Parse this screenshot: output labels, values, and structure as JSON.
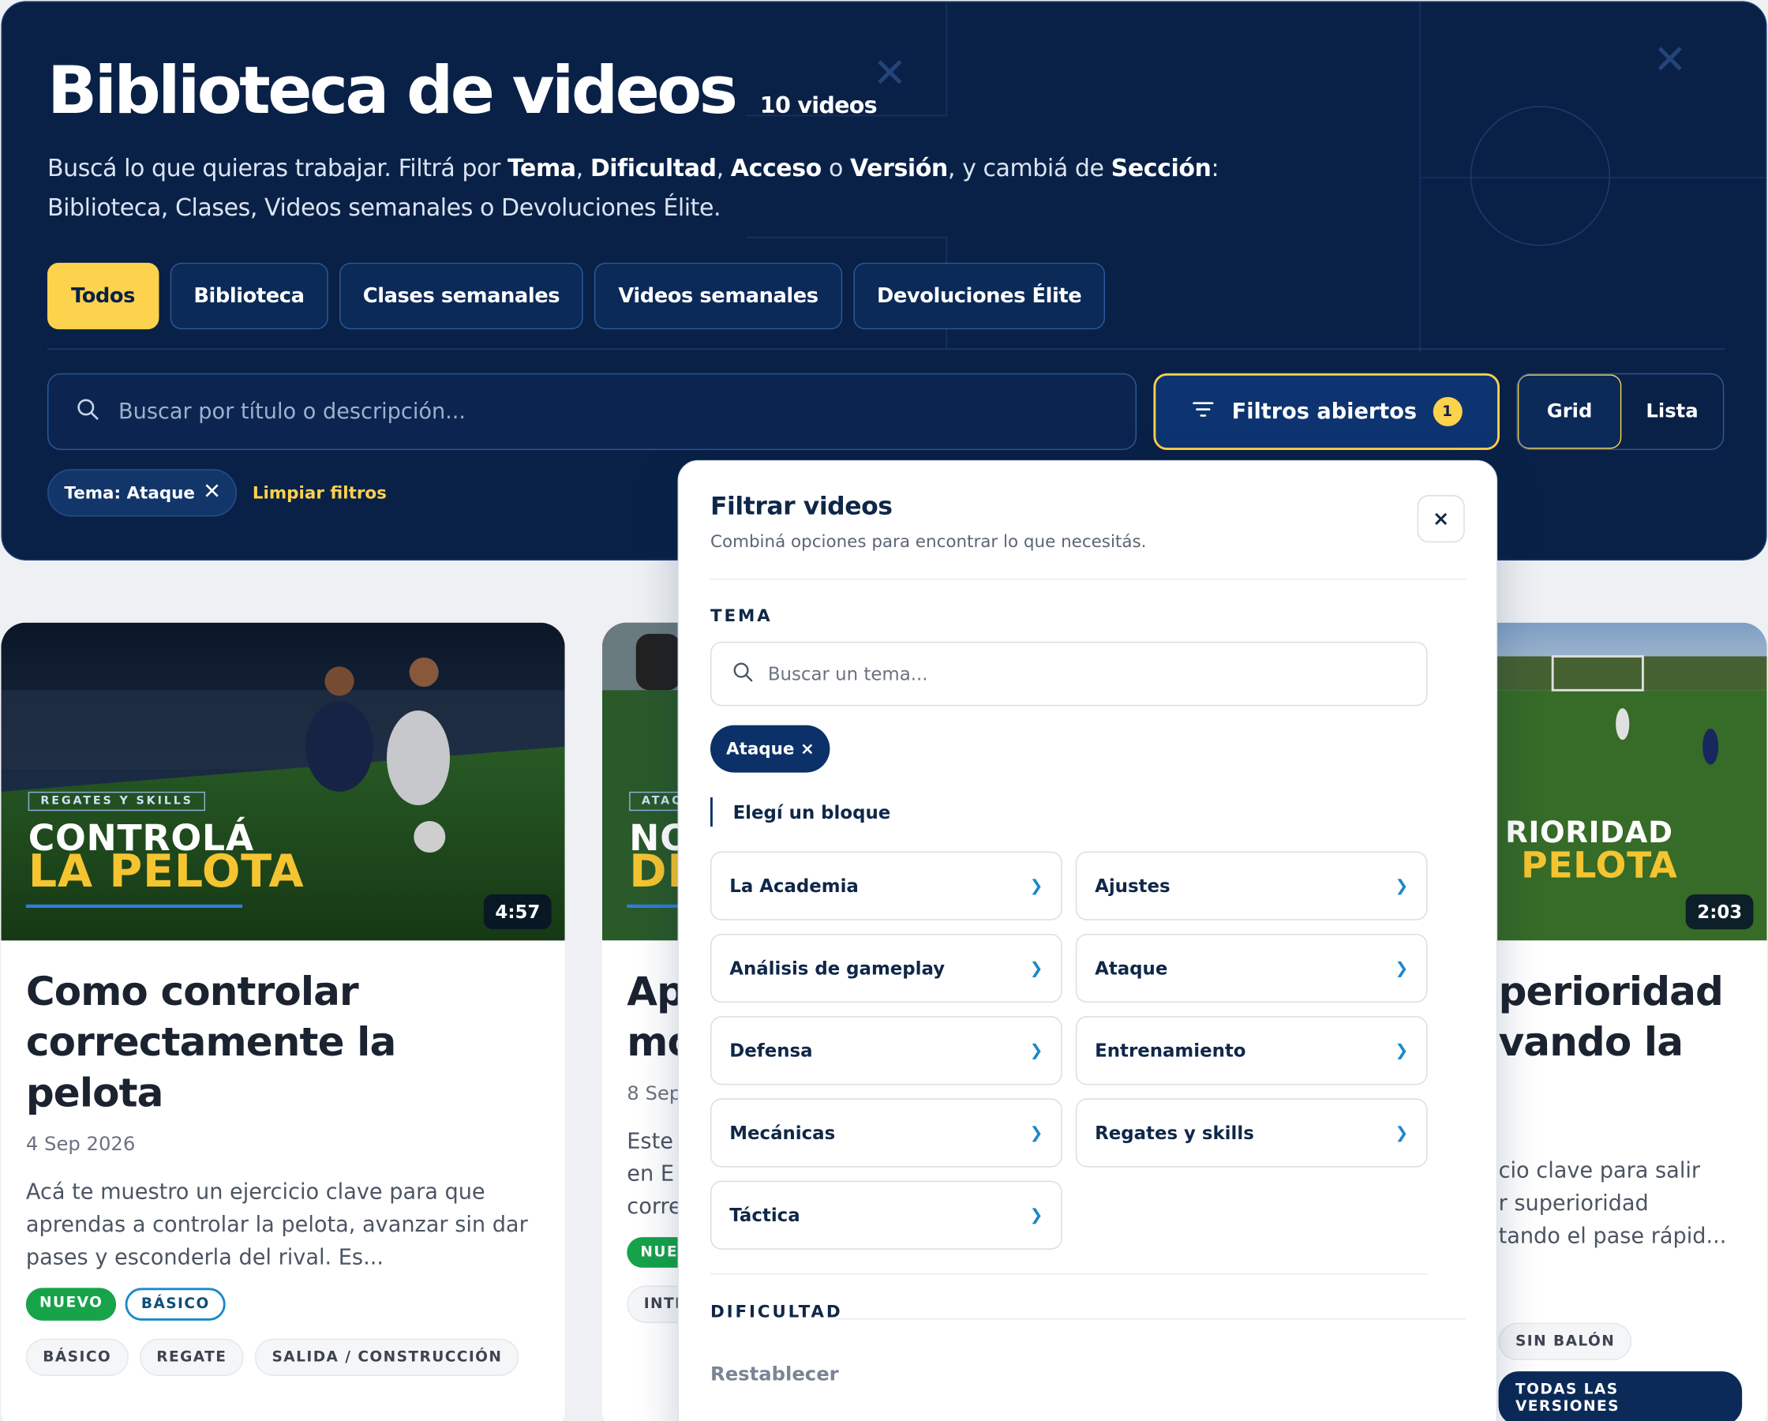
{
  "hero": {
    "title": "Biblioteca de videos",
    "count": "10 videos",
    "desc_1": "Buscá lo que quieras trabajar. Filtrá por ",
    "desc_tema": "Tema",
    "desc_c1": ", ",
    "desc_dificultad": "Dificultad",
    "desc_c2": ", ",
    "desc_acceso": "Acceso",
    "desc_o": " o ",
    "desc_version": "Versión",
    "desc_2": ", y cambiá de ",
    "desc_seccion": "Sección",
    "desc_3": ": Biblioteca, Clases, Videos semanales o Devoluciones Élite."
  },
  "tabs": [
    {
      "label": "Todos",
      "active": true
    },
    {
      "label": "Biblioteca",
      "active": false
    },
    {
      "label": "Clases semanales",
      "active": false
    },
    {
      "label": "Videos semanales",
      "active": false
    },
    {
      "label": "Devoluciones Élite",
      "active": false
    }
  ],
  "search": {
    "placeholder": "Buscar por título o descripción..."
  },
  "filters_button": {
    "label": "Filtros abiertos",
    "count": "1"
  },
  "view_toggle": {
    "grid": "Grid",
    "list": "Lista",
    "active": "grid"
  },
  "active_filters": {
    "chip": "Tema: Ataque",
    "clear": "Limpiar filtros"
  },
  "cards": [
    {
      "kicker": "REGATES Y SKILLS",
      "thumb_line1": "CONTROLÁ",
      "thumb_line2": "LA PELOTA",
      "duration": "4:57",
      "title": "Como controlar correctamente la pelota",
      "date": "4 Sep 2026",
      "desc": "Acá te muestro un ejercicio clave para que aprendas a controlar la pelota, avanzar sin dar pases y esconderla del rival. Es...",
      "badge_new": "NUEVO",
      "badge_level": "BÁSICO",
      "tags": [
        "BÁSICO",
        "REGATE",
        "SALIDA / CONSTRUCCIÓN"
      ]
    },
    {
      "kicker": "ATAQ",
      "thumb_line1": "NO",
      "thumb_line2": "DE",
      "title_visible": "Ap",
      "title_visible2": "mo",
      "date_visible": "8 Sep",
      "desc_visible_1": "Este",
      "desc_visible_2": "en E",
      "desc_visible_3": "corre",
      "badge_new": "NUE",
      "tag_visible": "INTE"
    },
    {
      "thumb_line1": "RIORIDAD",
      "thumb_line2": "PELOTA",
      "duration": "2:03",
      "title_visible": "perioridad",
      "title_visible2": "vando la",
      "desc_visible_1": "cio clave para salir",
      "desc_visible_2": "r superioridad",
      "desc_visible_3": "tando el pase rápid...",
      "tag_visible": "SIN BALÓN",
      "version_badge": "TODAS LAS VERSIONES"
    }
  ],
  "filter_panel": {
    "title": "Filtrar videos",
    "subtitle": "Combiná opciones para encontrar lo que necesitás.",
    "close": "×",
    "section_tema": "TEMA",
    "tema_search_placeholder": "Buscar un tema...",
    "selected_chip": "Ataque ×",
    "block_label": "Elegí un bloque",
    "items": [
      "La Academia",
      "Ajustes",
      "Análisis de gameplay",
      "Ataque",
      "Defensa",
      "Entrenamiento",
      "Mecánicas",
      "Regates y skills",
      "Táctica"
    ],
    "section_dificultad": "DIFICULTAD",
    "reset": "Restablecer"
  }
}
